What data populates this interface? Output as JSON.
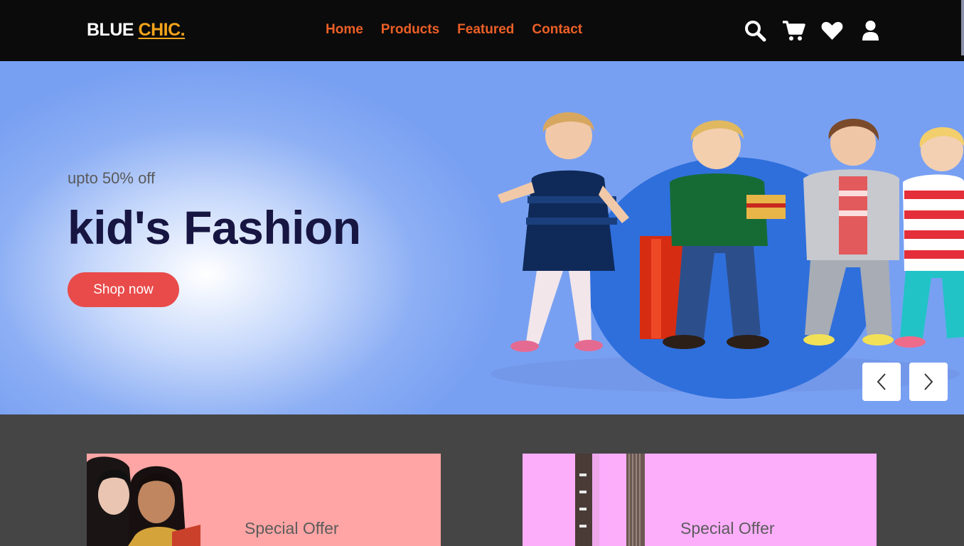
{
  "header": {
    "logo_main": "BLUE",
    "logo_accent": "CHIC.",
    "nav": [
      {
        "label": "Home"
      },
      {
        "label": "Products"
      },
      {
        "label": "Featured"
      },
      {
        "label": "Contact"
      }
    ],
    "icons": [
      "search-icon",
      "cart-icon",
      "heart-icon",
      "user-icon"
    ]
  },
  "hero": {
    "subtitle": "upto 50% off",
    "title": "kid's Fashion",
    "cta_label": "Shop now",
    "prev_icon": "chevron-left-icon",
    "next_icon": "chevron-right-icon"
  },
  "offers": [
    {
      "label": "Special Offer"
    },
    {
      "label": "Special Offer"
    }
  ],
  "colors": {
    "header_bg": "#0b0b0b",
    "nav_link": "#ec5f27",
    "logo_accent": "#f2a31b",
    "cta_bg": "#e84b4a",
    "hero_title": "#171541",
    "page_bg": "#454545",
    "offer_one_bg": "#ffa5a5",
    "offer_two_bg": "#fdaefb"
  }
}
